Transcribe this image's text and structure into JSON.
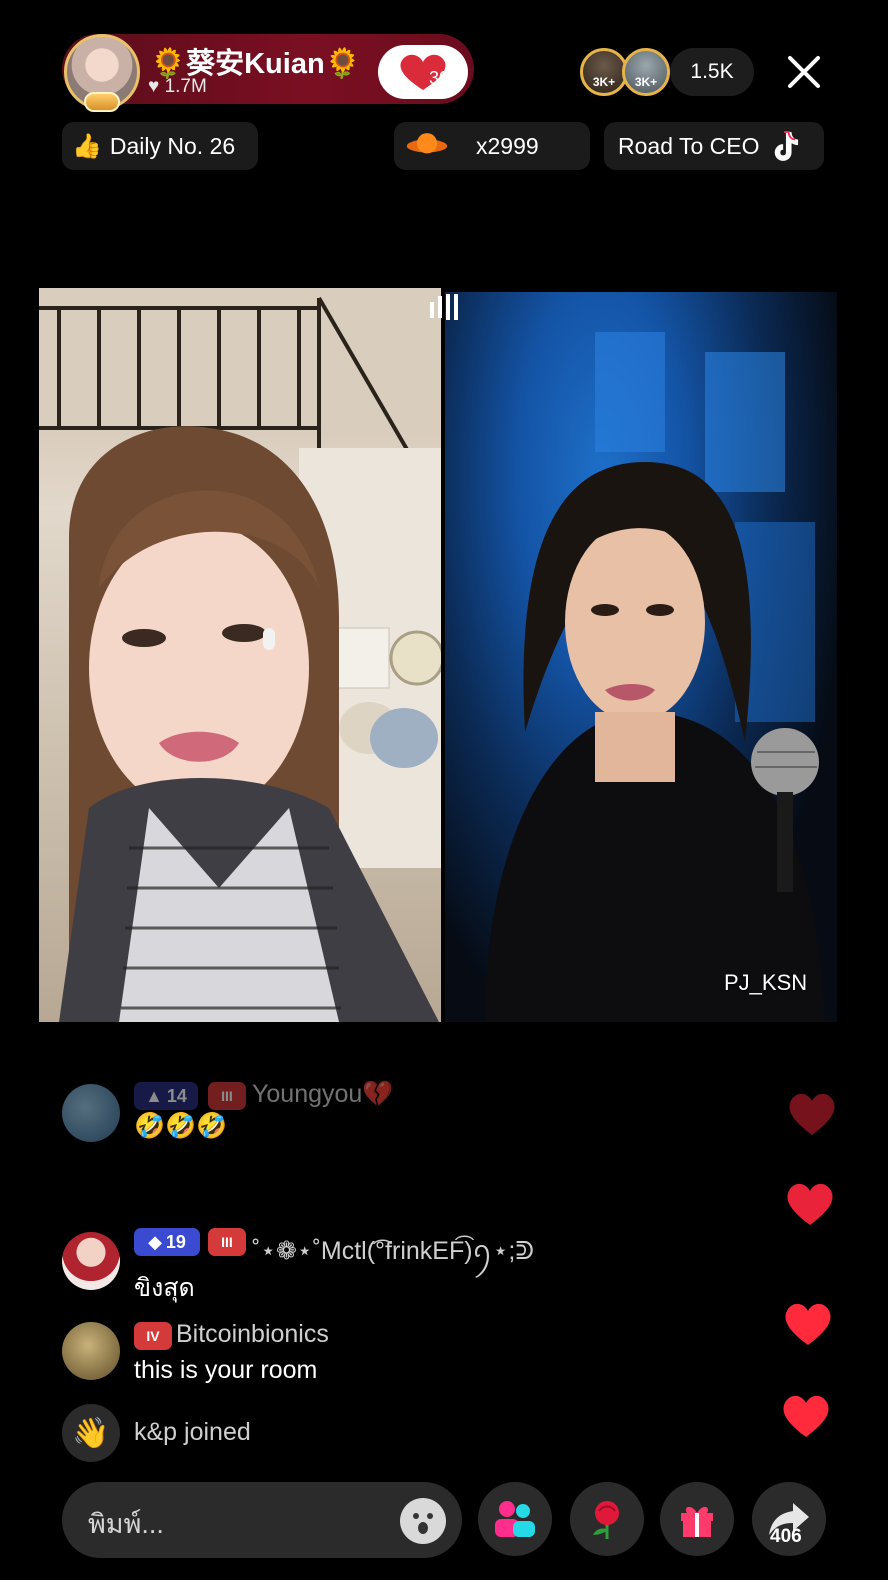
{
  "header": {
    "host_name": "🌻葵安Kuian🌻",
    "host_likes": "1.7M",
    "follow_badge_count": "30",
    "top_viewers": [
      {
        "label": "3K+",
        "color": "#3c2a18"
      },
      {
        "label": "3K+",
        "color": "#5e6a70"
      }
    ],
    "viewer_count": "1.5K"
  },
  "chips": {
    "daily": "Daily No. 26",
    "gift_count": "x2999",
    "road": "Road To CEO"
  },
  "partner": {
    "name": "PJ_KSN"
  },
  "comments": [
    {
      "level": "14",
      "fan_level": "III",
      "user": "Youngyou💔",
      "text": "🤣🤣🤣"
    },
    {
      "level": "19",
      "fan_level": "III",
      "user": "˚⋆❁⋆˚Mctl(͡°frinkEF͡)ꪆ⋆;ᕲ",
      "text": "ขิงสุด"
    },
    {
      "fan_level": "IV",
      "user": "Bitcoinbionics",
      "text": "this is your room"
    },
    {
      "user": "k&p",
      "action": "joined"
    }
  ],
  "bottom": {
    "input_placeholder": "พิมพ์...",
    "share_count": "406"
  },
  "icons": {
    "like": "heart-icon",
    "close": "close-icon",
    "flame": "flame-icon",
    "gift": "gift-icon",
    "rose": "rose-icon",
    "share": "share-icon",
    "emoji": "emoji-icon",
    "multi-guest": "multi-guest-icon",
    "wave": "wave-icon",
    "tiktok": "tiktok-icon",
    "planet": "planet-icon",
    "signal": "signal-icon"
  },
  "colors": {
    "host_pill": "#6a0c1d",
    "heart": "#e8233a",
    "level_badge_purple": "#3b4bd1",
    "level_badge_dark": "#2a3080",
    "fan_badge": "#d43a3a"
  }
}
